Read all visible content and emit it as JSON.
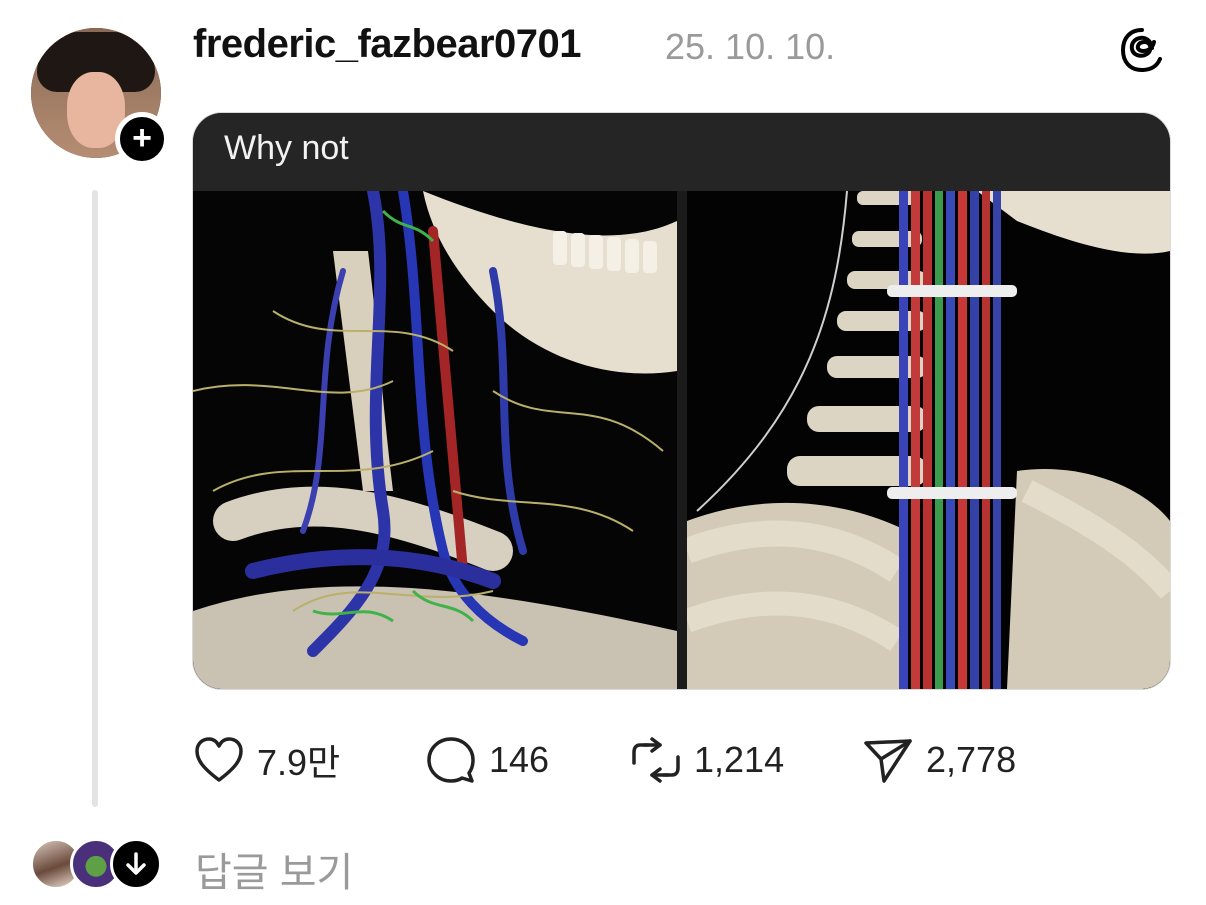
{
  "post": {
    "username": "frederic_fazbear0701",
    "timestamp": "25. 10. 10.",
    "caption": "Why not",
    "follow_symbol": "+"
  },
  "stats": {
    "likes": "7.9만",
    "comments": "146",
    "reposts": "1,214",
    "shares": "2,778"
  },
  "replies": {
    "label": "답글 보기"
  },
  "icons": {
    "brand": "threads-logo-icon",
    "like": "heart-icon",
    "comment": "speech-bubble-icon",
    "repost": "repost-arrows-icon",
    "share": "paper-plane-icon",
    "expand": "arrow-down-icon"
  },
  "colors": {
    "text": "#111111",
    "muted": "#9a9a9a",
    "thread_line": "#e3e3e3",
    "caption_bar": "#252525"
  }
}
